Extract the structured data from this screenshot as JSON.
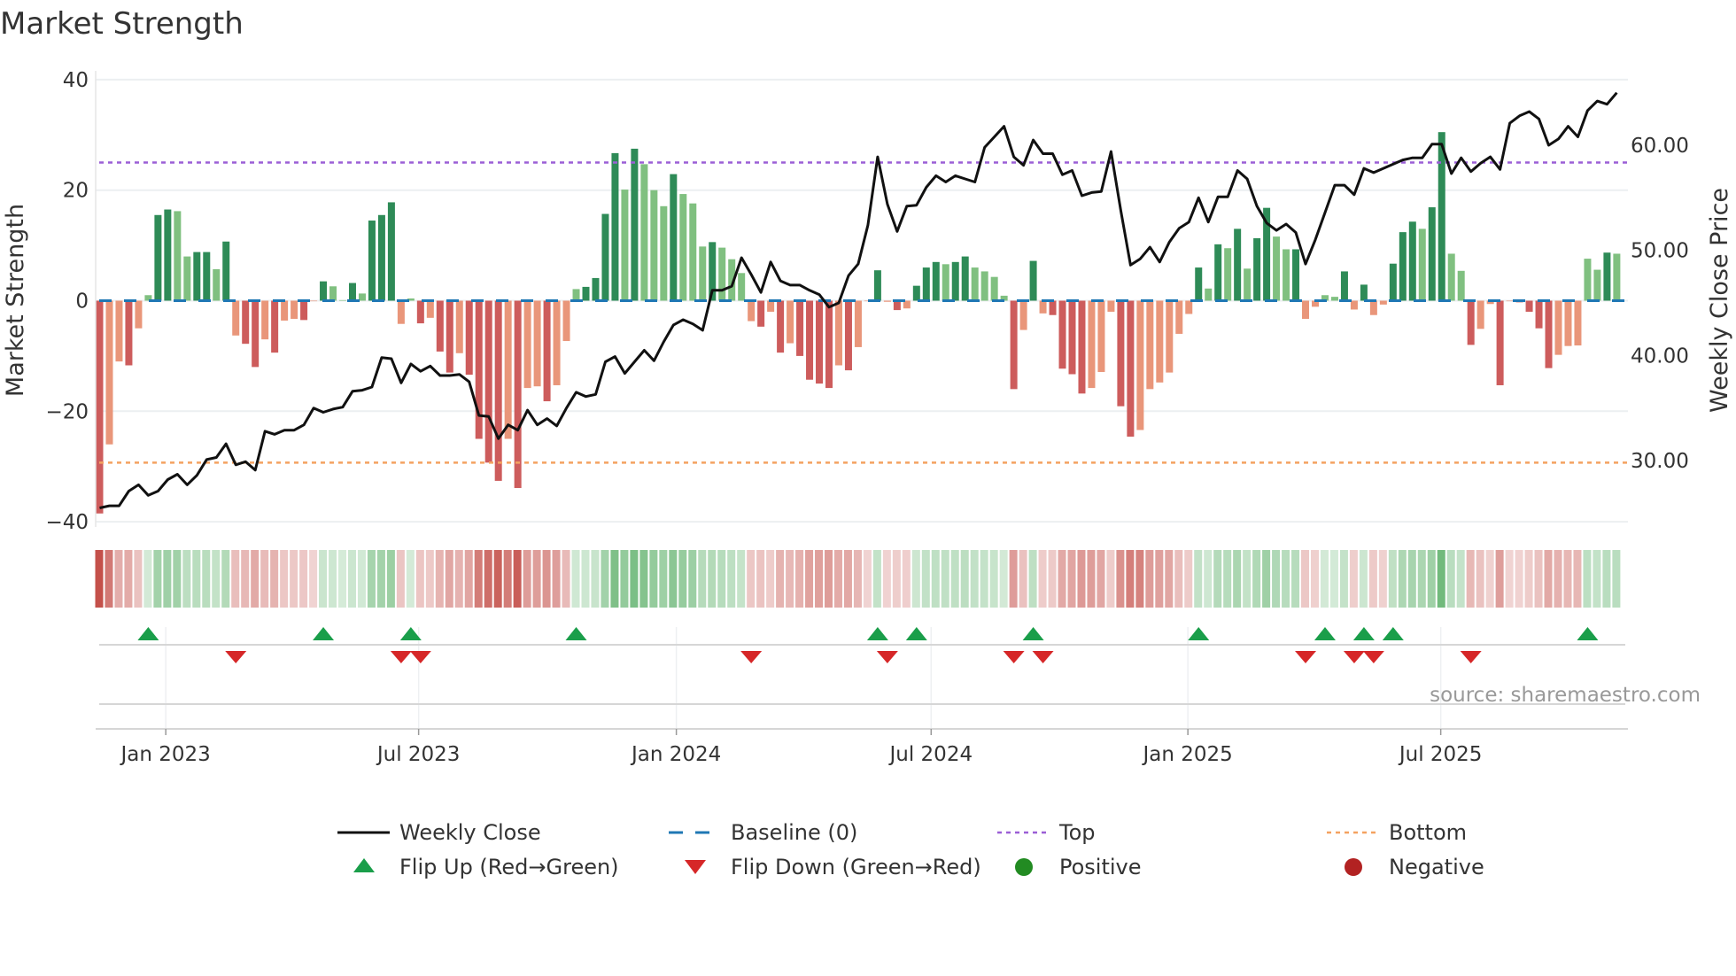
{
  "chart_data": {
    "type": "bar",
    "title": "Market Strength",
    "ylabel": "Market Strength",
    "y2label": "Weekly Close Price",
    "ylim": [
      -40,
      40
    ],
    "y2lim": [
      23.6,
      67.3
    ],
    "yticks": [
      "40",
      "20",
      "0",
      "−20",
      "−40"
    ],
    "ytick_values": [
      40,
      20,
      0,
      -20,
      -40
    ],
    "y2ticks": [
      "60.00",
      "50.00",
      "40.00",
      "30.00"
    ],
    "y2tick_values": [
      60,
      50,
      40,
      30
    ],
    "xticks": [
      "Jan 2023",
      "Jul 2023",
      "Jan 2024",
      "Jul 2024",
      "Jan 2025",
      "Jul 2025"
    ],
    "xtick_weeks": [
      6.8,
      32.8,
      59.3,
      85.5,
      111.9,
      137.9
    ],
    "top_level": 25,
    "bottom_level": -29.3,
    "grid": true,
    "legend_placement": "bottom",
    "strength": [
      -38.5,
      -26,
      -11,
      -11.7,
      -5,
      1,
      15.5,
      16.5,
      16.2,
      8,
      8.8,
      8.8,
      5.7,
      10.7,
      -6.3,
      -7.8,
      -12,
      -7,
      -9.4,
      -3.6,
      -3.3,
      -3.5,
      -0.1,
      3.5,
      2.6,
      0.1,
      3.2,
      1.3,
      14.5,
      15.5,
      17.8,
      -4.2,
      0.4,
      -4.1,
      -3.1,
      -9.2,
      -13,
      -9.5,
      -13.4,
      -25,
      -29.3,
      -32.6,
      -25,
      -33.9,
      -15.8,
      -15.5,
      -18.2,
      -15.3,
      -7.3,
      2.1,
      2.5,
      4.1,
      15.7,
      26.7,
      20.1,
      27.5,
      24.7,
      20,
      17.1,
      22.9,
      19.3,
      17.6,
      9.8,
      10.6,
      9.6,
      7.5,
      5,
      -3.7,
      -4.7,
      -2,
      -9.4,
      -7.7,
      -10,
      -14.3,
      -15,
      -15.8,
      -11.7,
      -12.6,
      -8.4,
      -0.1,
      5.5,
      -0.2,
      -1.7,
      -1.4,
      2.7,
      6,
      7,
      6.6,
      7,
      8,
      6,
      5.3,
      4.3,
      0.9,
      -16,
      -5.3,
      7.2,
      -2.3,
      -2.6,
      -12.3,
      -13.3,
      -16.8,
      -15.8,
      -12.9,
      -2,
      -19.1,
      -24.6,
      -23.4,
      -16,
      -14.8,
      -13,
      -6,
      -2.4,
      6,
      2.2,
      10.2,
      9.5,
      13,
      5.8,
      11.3,
      16.8,
      11.6,
      9.3,
      9.3,
      -3.3,
      -1.1,
      1,
      0.7,
      5.3,
      -1.6,
      2.9,
      -2.6,
      -0.7,
      6.7,
      12.4,
      14.3,
      13,
      16.9,
      30.5,
      8.5,
      5.4,
      -8,
      -5.1,
      -0.6,
      -15.3,
      -0.1,
      -0.3,
      -2,
      -5,
      -12.2,
      -9.8,
      -8.2,
      -8.1,
      7.6,
      5.6,
      8.7,
      8.5
    ],
    "weekly_close": [
      25.5,
      25.7,
      25.7,
      27.1,
      27.7,
      26.7,
      27.1,
      28.2,
      28.7,
      27.7,
      28.6,
      30.1,
      30.3,
      31.6,
      29.6,
      29.9,
      29.1,
      32.8,
      32.5,
      32.9,
      32.9,
      33.4,
      35.0,
      34.6,
      34.9,
      35.1,
      36.6,
      36.7,
      37.0,
      39.8,
      39.7,
      37.4,
      39.2,
      38.5,
      39.0,
      38.1,
      38.1,
      38.2,
      37.5,
      34.3,
      34.2,
      32.1,
      33.4,
      32.9,
      34.8,
      33.4,
      34.0,
      33.3,
      35.0,
      36.5,
      36.1,
      36.3,
      39.4,
      39.9,
      38.3,
      39.4,
      40.5,
      39.5,
      41.3,
      42.9,
      43.4,
      43.0,
      42.4,
      46.2,
      46.2,
      46.6,
      49.3,
      47.7,
      46.0,
      48.9,
      47.1,
      46.7,
      46.7,
      46.2,
      45.8,
      44.6,
      45.0,
      47.6,
      48.7,
      52.4,
      58.9,
      54.4,
      51.8,
      54.2,
      54.3,
      56.0,
      57.1,
      56.5,
      57.1,
      56.8,
      56.5,
      59.8,
      60.8,
      61.8,
      58.9,
      58.1,
      60.5,
      59.2,
      59.2,
      57.2,
      57.6,
      55.2,
      55.5,
      55.6,
      59.4,
      53.8,
      48.6,
      49.2,
      50.3,
      48.9,
      50.8,
      52.1,
      52.7,
      55.0,
      52.7,
      55.1,
      55.1,
      57.6,
      56.8,
      54.2,
      52.6,
      51.9,
      52.5,
      51.7,
      48.7,
      51.0,
      53.6,
      56.2,
      56.2,
      55.3,
      57.8,
      57.4,
      57.8,
      58.2,
      58.6,
      58.8,
      58.8,
      60.1,
      60.1,
      57.3,
      58.8,
      57.5,
      58.3,
      58.9,
      57.7,
      62.1,
      62.8,
      63.2,
      62.5,
      60.0,
      60.6,
      61.8,
      60.8,
      63.3,
      64.2,
      63.9,
      65.0
    ],
    "flip_up_weeks": [
      5,
      23,
      32,
      49,
      80,
      84,
      96,
      113,
      126,
      130,
      133,
      153
    ],
    "flip_down_weeks": [
      14,
      31,
      33,
      67,
      81,
      94,
      97,
      124,
      129,
      131,
      141
    ],
    "legend": [
      {
        "key": "close",
        "label": "Weekly Close"
      },
      {
        "key": "baseline",
        "label": "Baseline (0)"
      },
      {
        "key": "top",
        "label": "Top"
      },
      {
        "key": "bottom",
        "label": "Bottom"
      },
      {
        "key": "flipup",
        "label": "Flip Up (Red→Green)"
      },
      {
        "key": "flipdown",
        "label": "Flip Down (Green→Red)"
      },
      {
        "key": "positive",
        "label": "Positive"
      },
      {
        "key": "negative",
        "label": "Negative"
      }
    ],
    "source": "source: sharemaestro.com"
  },
  "colors": {
    "pos_strong": "#2e8b57",
    "pos_weak": "#80c080",
    "neg_strong": "#cd5c5c",
    "neg_weak": "#e9967a",
    "baseline": "#1f77b4",
    "top": "#9b5fd6",
    "bottom": "#f4a261",
    "close": "#111111",
    "flip_up": "#1a9e4a",
    "flip_down": "#d62728",
    "positive": "#228b22",
    "negative": "#b22222"
  }
}
